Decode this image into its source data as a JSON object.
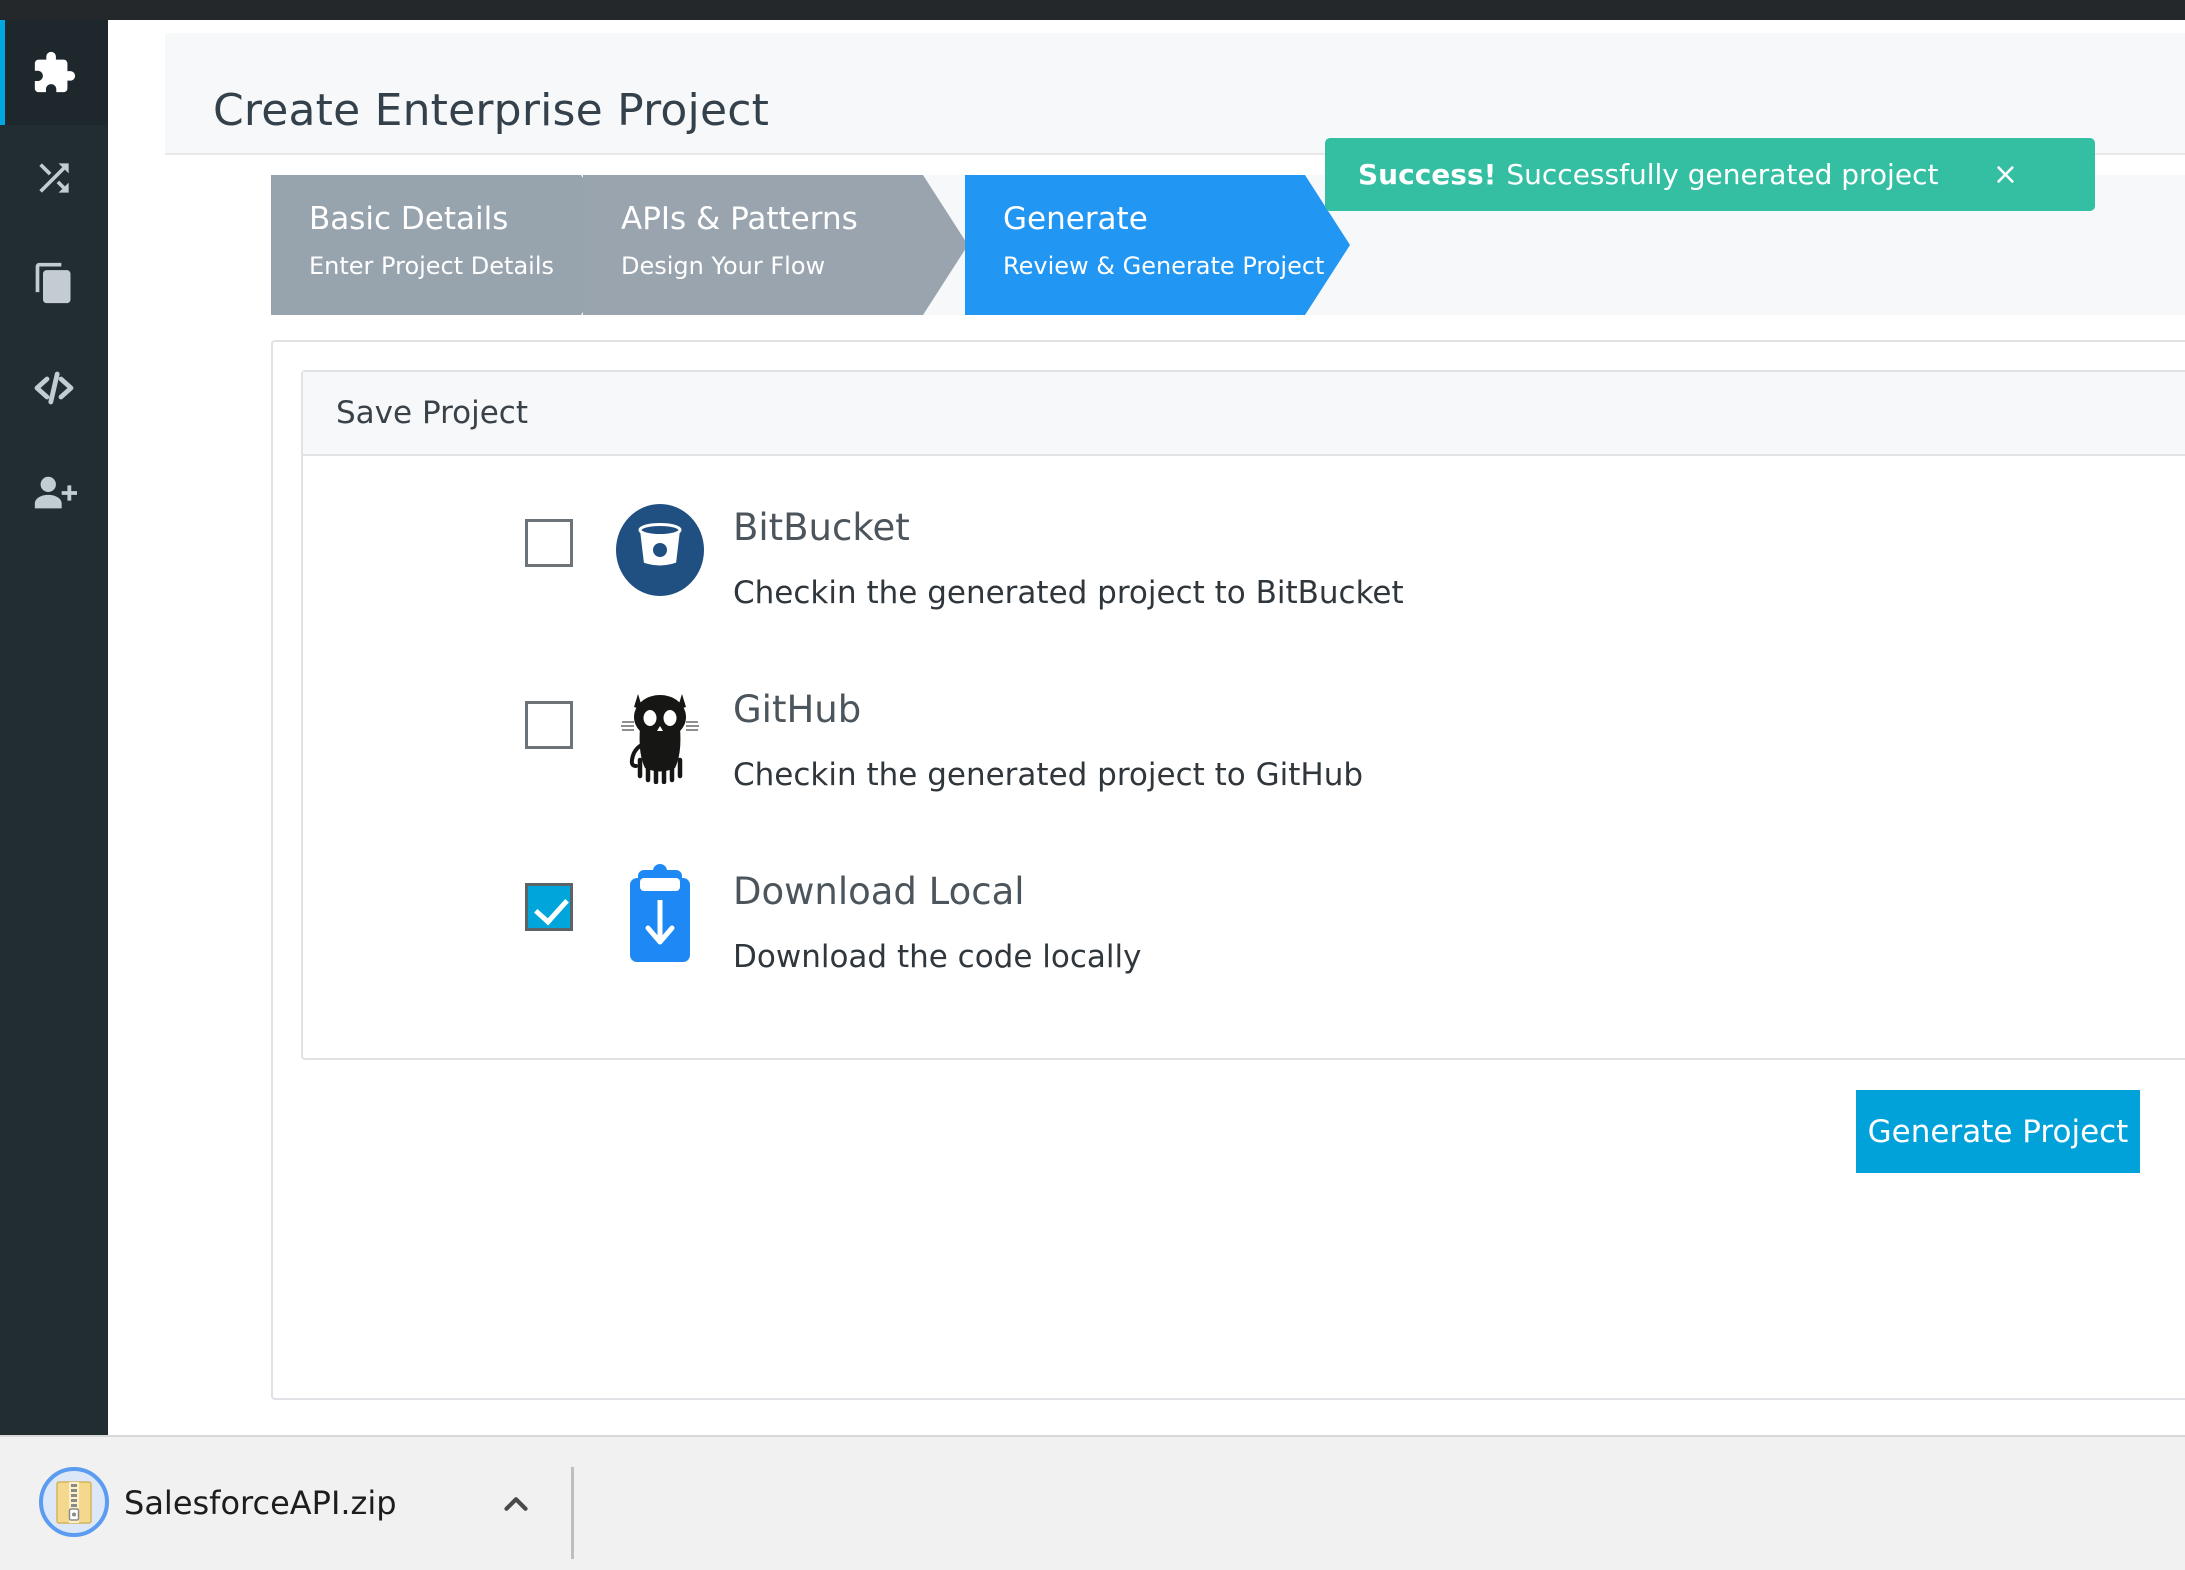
{
  "window": {
    "top_strip_color": "#25282a"
  },
  "sidebar": {
    "background": "#222d32",
    "accent_color": "#00a7e1",
    "items": [
      {
        "name": "puzzle-piece-icon",
        "label": "Plugins",
        "active": true
      },
      {
        "name": "shuffle-icon",
        "label": "Flows",
        "active": false
      },
      {
        "name": "copy-icon",
        "label": "Clone",
        "active": false
      },
      {
        "name": "code-icon",
        "label": "Code",
        "active": false
      },
      {
        "name": "user-plus-icon",
        "label": "Add User",
        "active": false
      }
    ]
  },
  "header": {
    "title": "Create Enterprise Project"
  },
  "wizard": {
    "steps": [
      {
        "title": "Basic Details",
        "subtitle": "Enter Project Details",
        "state": "complete",
        "color": "#97a3ad"
      },
      {
        "title": "APIs & Patterns",
        "subtitle": "Design Your Flow",
        "state": "complete",
        "color": "#99a4ae"
      },
      {
        "title": "Generate",
        "subtitle": "Review & Generate Project",
        "state": "active",
        "color": "#2196f3"
      }
    ]
  },
  "toast": {
    "strong": "Success!",
    "message": "Successfully generated project",
    "close_label": "×",
    "color": "#34bfa3"
  },
  "save_panel": {
    "title": "Save Project",
    "options": [
      {
        "id": "bitbucket",
        "icon": "bitbucket-icon",
        "label": "BitBucket",
        "description": "Checkin the generated project to BitBucket",
        "checked": false,
        "icon_color": "#205081"
      },
      {
        "id": "github",
        "icon": "github-icon",
        "label": "GitHub",
        "description": "Checkin the generated project to GitHub",
        "checked": false,
        "icon_color": "#161614"
      },
      {
        "id": "download-local",
        "icon": "clipboard-download-icon",
        "label": "Download Local",
        "description": "Download the code locally",
        "checked": true,
        "icon_color": "#1e88f5"
      }
    ]
  },
  "actions": {
    "generate_label": "Generate Project",
    "generate_color": "#00a2d9"
  },
  "download_bar": {
    "filename": "SalesforceAPI.zip",
    "file_icon": "zip-file-icon",
    "chevron_icon": "chevron-up-icon"
  }
}
